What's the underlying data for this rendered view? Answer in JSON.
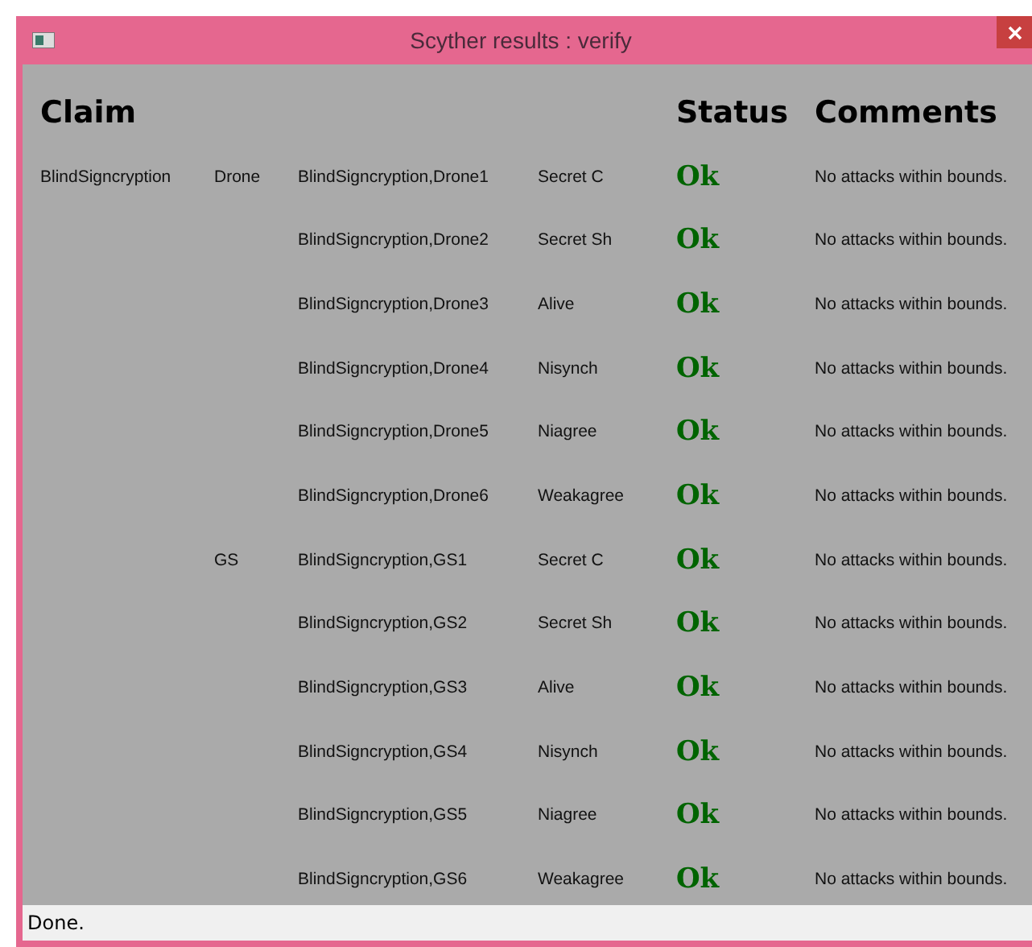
{
  "window": {
    "title": "Scyther results : verify"
  },
  "table": {
    "columns": [
      "Claim",
      "Status",
      "Comments"
    ],
    "rows": [
      {
        "protocol": "BlindSigncryption",
        "role": "Drone",
        "claim_id": "BlindSigncryption,Drone1",
        "claim_type": "Secret C",
        "status": "Ok",
        "comment": "No attacks within bounds."
      },
      {
        "claim_id": "BlindSigncryption,Drone2",
        "claim_type": "Secret Sh",
        "status": "Ok",
        "comment": "No attacks within bounds."
      },
      {
        "claim_id": "BlindSigncryption,Drone3",
        "claim_type": "Alive",
        "status": "Ok",
        "comment": "No attacks within bounds."
      },
      {
        "claim_id": "BlindSigncryption,Drone4",
        "claim_type": "Nisynch",
        "status": "Ok",
        "comment": "No attacks within bounds."
      },
      {
        "claim_id": "BlindSigncryption,Drone5",
        "claim_type": "Niagree",
        "status": "Ok",
        "comment": "No attacks within bounds."
      },
      {
        "claim_id": "BlindSigncryption,Drone6",
        "claim_type": "Weakagree",
        "status": "Ok",
        "comment": "No attacks within bounds."
      },
      {
        "role": "GS",
        "claim_id": "BlindSigncryption,GS1",
        "claim_type": "Secret C",
        "status": "Ok",
        "comment": "No attacks within bounds."
      },
      {
        "claim_id": "BlindSigncryption,GS2",
        "claim_type": "Secret Sh",
        "status": "Ok",
        "comment": "No attacks within bounds."
      },
      {
        "claim_id": "BlindSigncryption,GS3",
        "claim_type": "Alive",
        "status": "Ok",
        "comment": "No attacks within bounds."
      },
      {
        "claim_id": "BlindSigncryption,GS4",
        "claim_type": "Nisynch",
        "status": "Ok",
        "comment": "No attacks within bounds."
      },
      {
        "claim_id": "BlindSigncryption,GS5",
        "claim_type": "Niagree",
        "status": "Ok",
        "comment": "No attacks within bounds."
      },
      {
        "claim_id": "BlindSigncryption,GS6",
        "claim_type": "Weakagree",
        "status": "Ok",
        "comment": "No attacks within bounds."
      }
    ]
  },
  "status_bar": "Done."
}
